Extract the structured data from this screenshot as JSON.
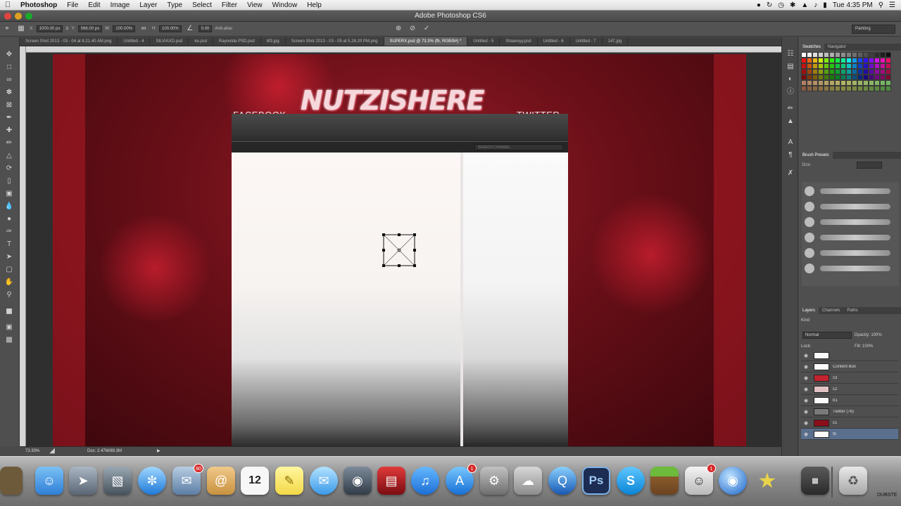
{
  "menubar": {
    "app": "Photoshop",
    "items": [
      "File",
      "Edit",
      "Image",
      "Layer",
      "Type",
      "Select",
      "Filter",
      "View",
      "Window",
      "Help"
    ],
    "clock": "Tue 4:35 PM"
  },
  "window": {
    "title": "Adobe Photoshop CS6"
  },
  "options": {
    "w": "1000.00 px",
    "h": "566.00 px",
    "wpct": "100.00%",
    "hpct": "100.00%",
    "angle": "0.00",
    "antialias": "Anti-alias",
    "workspace": "Painting"
  },
  "tabs": [
    {
      "label": "Screen Shot 2013 - 03 - 04 at 8.21.40 AM.png"
    },
    {
      "label": "Untitled - 4"
    },
    {
      "label": "SILVIAXD.psd"
    },
    {
      "label": "ke.psd"
    },
    {
      "label": "Raynolda PSD.psd"
    },
    {
      "label": "bf3.jpg"
    },
    {
      "label": "Screen Shot 2013 - 03 - 05 at 5.28.20 PM.png"
    },
    {
      "label": "SUPERX.psd @ 73.3% (fb, RGB/8#) *"
    },
    {
      "label": "Untitled - 5"
    },
    {
      "label": "Shaareyy.psd"
    },
    {
      "label": "Untitled - 6"
    },
    {
      "label": "Untitled - 7"
    },
    {
      "label": "147.jpg"
    }
  ],
  "document": {
    "logo": "NUTZISHERE",
    "facebook": "FACEBOOK",
    "twitter": "TWITTER",
    "search_placeholder": "SEARCH CHANNEL"
  },
  "status": {
    "zoom": "73.33%",
    "doc": "Doc: 2.47M/89.3M"
  },
  "panels": {
    "swatches_tab": "Swatches",
    "navigator_tab": "Navigator",
    "brush_presets": "Brush Presets",
    "size_label": "Size:",
    "layers_tab": "Layers",
    "channels_tab": "Channels",
    "paths_tab": "Paths",
    "kind": "Kind",
    "blend_mode": "Normal",
    "opacity_label": "Opacity:",
    "opacity": "100%",
    "lock_label": "Lock:",
    "fill_label": "Fill:",
    "fill": "100%",
    "layers": [
      {
        "name": ""
      },
      {
        "name": "Content Box"
      },
      {
        "name": "c3"
      },
      {
        "name": "c2"
      },
      {
        "name": "b1"
      },
      {
        "name": "Twitter (76)"
      },
      {
        "name": "c1"
      },
      {
        "name": "fb"
      }
    ]
  },
  "dock": {
    "apps": [
      "Finder",
      "Launchpad",
      "App Store Utility",
      "Safari",
      "Mail",
      "Contacts",
      "Calendar",
      "Stickies",
      "Messages",
      "FaceTime",
      "Photo Booth",
      "iTunes",
      "App Store",
      "System Preferences",
      "Preview",
      "QuickTime",
      "Photoshop",
      "Skype",
      "Minecraft",
      "Mac Trash",
      "Browser",
      "Star",
      "Terminal",
      "Trash"
    ],
    "calendar_day": "12",
    "mail_badge": "80",
    "appstore_badge": "1",
    "app_badge": "1",
    "dubstep": "DUBSTE"
  },
  "colors": {
    "accent": "#c2182a",
    "ps_blue": "#1c2c52",
    "selected_layer": "#5a6f8e"
  }
}
